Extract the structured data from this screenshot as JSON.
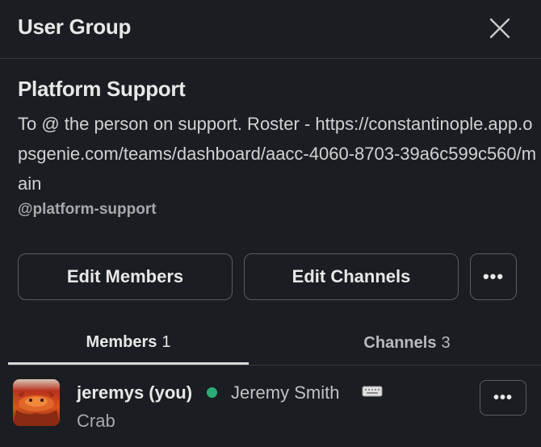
{
  "header": {
    "title": "User Group",
    "close_icon": "close-icon"
  },
  "group": {
    "name": "Platform Support",
    "description": "To @ the person on support. Roster - https://constantinople.app.opsgenie.com/teams/dashboard/aacc-4060-8703-39a6c599c560/main",
    "handle": "@platform-support"
  },
  "actions": {
    "edit_members": "Edit Members",
    "edit_channels": "Edit Channels",
    "more": "•••"
  },
  "tabs": [
    {
      "label": "Members",
      "count": "1",
      "active": true
    },
    {
      "label": "Channels",
      "count": "3",
      "active": false
    }
  ],
  "members": [
    {
      "username": "jeremys (you)",
      "presence": "active",
      "real_name": "Jeremy Smith",
      "status_icon": "keyboard-icon",
      "title": "Crab",
      "more": "•••"
    }
  ],
  "colors": {
    "background": "#1a1d21",
    "presence_active": "#2bac76"
  }
}
